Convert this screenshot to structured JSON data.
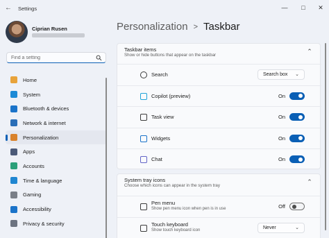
{
  "window": {
    "title": "Settings",
    "controls": [
      "minimize-icon",
      "maximize-icon",
      "close-icon"
    ]
  },
  "user": {
    "name": "Ciprian Rusen"
  },
  "search": {
    "placeholder": "Find a setting",
    "icon": "search-icon"
  },
  "sidebar": {
    "items": [
      {
        "label": "Home",
        "icon": "home-icon",
        "color": "#e8a33a",
        "active": false
      },
      {
        "label": "System",
        "icon": "system-icon",
        "color": "#1c8ad6",
        "active": false
      },
      {
        "label": "Bluetooth & devices",
        "icon": "bluetooth-icon",
        "color": "#1a73c9",
        "active": false
      },
      {
        "label": "Network & internet",
        "icon": "network-icon",
        "color": "#2a6fb8",
        "active": false
      },
      {
        "label": "Personalization",
        "icon": "brush-icon",
        "color": "#d9822b",
        "active": true
      },
      {
        "label": "Apps",
        "icon": "apps-icon",
        "color": "#4b5a78",
        "active": false
      },
      {
        "label": "Accounts",
        "icon": "accounts-icon",
        "color": "#2ba07a",
        "active": false
      },
      {
        "label": "Time & language",
        "icon": "time-language-icon",
        "color": "#1f86d1",
        "active": false
      },
      {
        "label": "Gaming",
        "icon": "gaming-icon",
        "color": "#7a7f88",
        "active": false
      },
      {
        "label": "Accessibility",
        "icon": "accessibility-icon",
        "color": "#1a73c9",
        "active": false
      },
      {
        "label": "Privacy & security",
        "icon": "shield-icon",
        "color": "#6c7380",
        "active": false
      }
    ]
  },
  "breadcrumb": {
    "parent": "Personalization",
    "separator": ">",
    "current": "Taskbar"
  },
  "taskbar_items": {
    "title": "Taskbar items",
    "description": "Show or hide buttons that appear on the taskbar",
    "rows": [
      {
        "label": "Search",
        "icon": "search-icon",
        "control": "dropdown",
        "value": "Search box"
      },
      {
        "label": "Copilot (preview)",
        "icon": "copilot-icon",
        "control": "toggle",
        "value": "On",
        "on": true
      },
      {
        "label": "Task view",
        "icon": "task-view-icon",
        "control": "toggle",
        "value": "On",
        "on": true
      },
      {
        "label": "Widgets",
        "icon": "widgets-icon",
        "control": "toggle",
        "value": "On",
        "on": true
      },
      {
        "label": "Chat",
        "icon": "chat-icon",
        "control": "toggle",
        "value": "On",
        "on": true
      }
    ]
  },
  "system_tray": {
    "title": "System tray icons",
    "description": "Choose which icons can appear in the system tray",
    "rows": [
      {
        "label": "Pen menu",
        "sub": "Show pen menu icon when pen is in use",
        "icon": "pen-icon",
        "control": "toggle",
        "value": "Off",
        "on": false
      },
      {
        "label": "Touch keyboard",
        "sub": "Show touch keyboard icon",
        "icon": "keyboard-icon",
        "control": "dropdown",
        "value": "Never"
      }
    ]
  },
  "colors": {
    "accent": "#0a5fb5",
    "background": "#eef1f7",
    "card": "#f9fafc"
  }
}
